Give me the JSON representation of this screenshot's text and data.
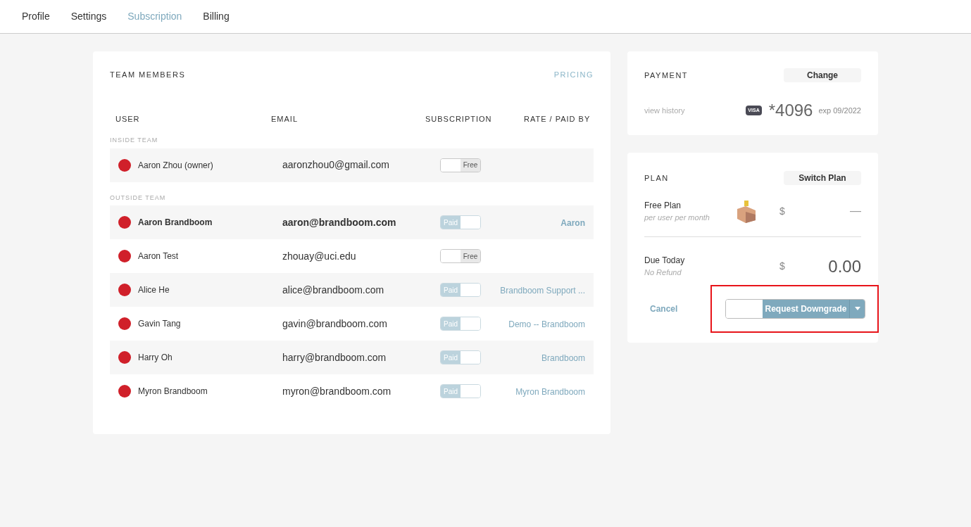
{
  "tabs": [
    {
      "label": "Profile",
      "selected": false
    },
    {
      "label": "Settings",
      "selected": false
    },
    {
      "label": "Subscription",
      "selected": true
    },
    {
      "label": "Billing",
      "selected": false
    }
  ],
  "team": {
    "title": "TEAM MEMBERS",
    "pricing_link": "PRICING",
    "columns": [
      "USER",
      "EMAIL",
      "SUBSCRIPTION",
      "RATE / PAID BY"
    ],
    "groups": [
      {
        "label": "INSIDE TEAM",
        "rows": [
          {
            "name": "Aaron Zhou (owner)",
            "email": "aaronzhou0@gmail.com",
            "paid": false,
            "toggle_label": "Free",
            "emphasized": false
          }
        ]
      },
      {
        "label": "OUTSIDE TEAM",
        "rows": [
          {
            "name": "Aaron Brandboom",
            "email": "aaron@brandboom.com",
            "paid": true,
            "toggle_label": "Paid",
            "paid_by": "Aaron",
            "emphasized": true
          },
          {
            "name": "Aaron Test",
            "email": "zhouay@uci.edu",
            "paid": false,
            "toggle_label": "Free",
            "emphasized": false
          },
          {
            "name": "Alice He",
            "email": "alice@brandboom.com",
            "paid": true,
            "toggle_label": "Paid",
            "paid_by": "Brandboom Support ...",
            "emphasized": false
          },
          {
            "name": "Gavin Tang",
            "email": "gavin@brandboom.com",
            "paid": true,
            "toggle_label": "Paid",
            "paid_by": "Demo -- Brandboom",
            "emphasized": false
          },
          {
            "name": "Harry Oh",
            "email": "harry@brandboom.com",
            "paid": true,
            "toggle_label": "Paid",
            "paid_by": "Brandboom",
            "emphasized": false
          },
          {
            "name": "Myron Brandboom",
            "email": "myron@brandboom.com",
            "paid": true,
            "toggle_label": "Paid",
            "paid_by": "Myron Brandboom",
            "emphasized": false
          }
        ]
      }
    ]
  },
  "payment": {
    "title": "PAYMENT",
    "button": "Change",
    "history_link": "view history",
    "card_brand": "VISA",
    "card_number": "*4096",
    "expiry": "exp 09/2022"
  },
  "plan": {
    "title": "PLAN",
    "button": "Switch Plan",
    "plan_name": "Free Plan",
    "plan_note": "per user per month",
    "currency": "$",
    "price": "—",
    "due_label": "Due Today",
    "due_note": "No Refund",
    "due_currency": "$",
    "due_amount": "0.00",
    "cancel": "Cancel",
    "submit": "Request Downgrade",
    "highlighted": true
  }
}
